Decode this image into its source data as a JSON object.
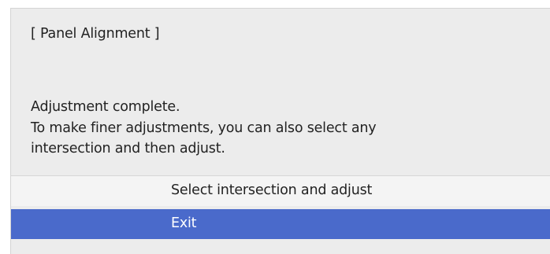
{
  "dialog": {
    "title": "[ Panel Alignment ]",
    "message_lines": [
      "Adjustment complete.",
      "To make finer adjustments, you can also select any",
      "intersection and then adjust."
    ],
    "options": [
      {
        "label": "Select intersection and adjust",
        "selected": false
      },
      {
        "label": "Exit",
        "selected": true
      }
    ]
  },
  "colors": {
    "panel_background": "#ececec",
    "selected_background": "#4a6acb",
    "selected_text": "#ffffff",
    "text": "#222222"
  }
}
